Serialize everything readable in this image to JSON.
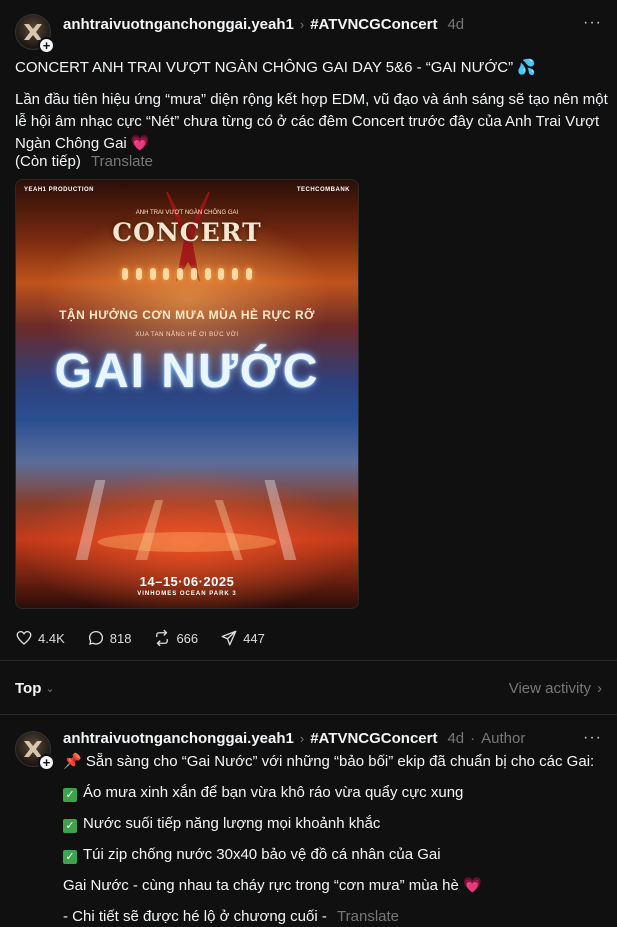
{
  "post": {
    "username": "anhtraivuotnganchonggai.yeah1",
    "hashtag": "#ATVNCGConcert",
    "time": "4d",
    "title_line": "CONCERT ANH TRAI VƯỢT NGÀN CHÔNG GAI DAY 5&6 - “GAI NƯỚC” 💦",
    "body_line1": "Lần đầu tiên hiệu ứng “mưa” diện rộng kết hợp EDM, vũ đạo và ánh sáng sẽ tạo nên một",
    "body_line2": "lễ hội âm nhạc cực “Nét” chưa từng có ở các đêm Concert trước đây của Anh Trai Vượt",
    "body_line3": "Ngàn Chông Gai 💗",
    "continued": "(Còn tiếp)",
    "translate": "Translate",
    "poster": {
      "logo_left": "YEAH1 PRODUCTION",
      "logo_right": "TECHCOMBANK",
      "small_title": "ANH TRAI VƯỢT NGÀN CHÔNG GAI",
      "concert": "CONCERT",
      "sub1": "TẬN HƯỞNG CƠN MƯA MÙA HÈ RỰC RỠ",
      "sub2": "XUA TAN NẮNG HÈ ƠI BỨC VỜI",
      "title": "GAI NƯỚC",
      "date": "14–15·06·2025",
      "venue": "VINHOMES OCEAN PARK 3"
    },
    "actions": {
      "likes": "4.4K",
      "comments": "818",
      "reposts": "666",
      "shares": "447"
    }
  },
  "sortbar": {
    "sort_label": "Top",
    "view_activity": "View activity"
  },
  "reply": {
    "username": "anhtraivuotnganchonggai.yeah1",
    "hashtag": "#ATVNCGConcert",
    "time": "4d",
    "author": "Author",
    "line1": "📌 Sẵn sàng cho “Gai Nước” với những “bảo bối” ekip đã chuẩn bị cho các Gai:",
    "item1": "Áo mưa xinh xắn để bạn vừa khô ráo vừa quẩy cực xung",
    "item2": "Nước suối tiếp năng lượng mọi khoảnh khắc",
    "item3": "Túi zip chống nước 30x40 bảo vệ đồ cá nhân của Gai",
    "line5": "Gai Nước - cùng nhau ta cháy rực trong “cơn mưa” mùa hè 💗",
    "line6": "- Chi tiết sẽ được hé lộ ở chương cuối -",
    "translate": "Translate"
  }
}
